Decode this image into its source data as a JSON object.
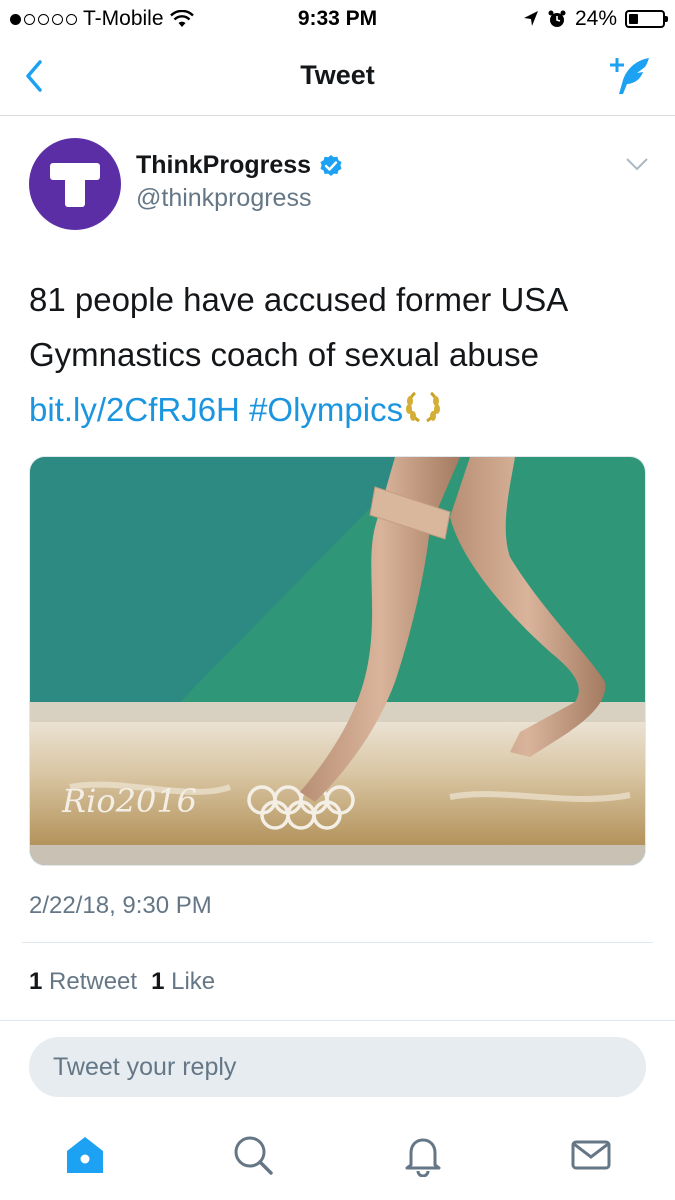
{
  "status_bar": {
    "carrier": "T-Mobile",
    "time": "9:33 PM",
    "battery": "24%",
    "battery_level": 0.24
  },
  "nav": {
    "title": "Tweet",
    "back_icon": "chevron-left-icon",
    "compose_icon": "compose-tweet-icon"
  },
  "tweet": {
    "display_name": "ThinkProgress",
    "handle": "@thinkprogress",
    "verified": true,
    "text_line1": "81 people have accused former USA",
    "text_line2": "Gymnastics coach of sexual abuse",
    "link": "bit.ly/2CfRJ6H",
    "hashtag": "#Olympics",
    "timestamp": "2/22/18, 9:30 PM",
    "media_watermark": "Rio2016"
  },
  "stats": {
    "retweets_count": "1",
    "retweets_label": "Retweet",
    "likes_count": "1",
    "likes_label": "Like"
  },
  "reply": {
    "placeholder": "Tweet your reply"
  },
  "tab_bar": [
    "home-icon",
    "search-icon",
    "notifications-icon",
    "messages-icon"
  ],
  "colors": {
    "accent": "#1da1f2",
    "link": "#1b95e0",
    "avatar_bg": "#5b2ea6",
    "secondary_text": "#657786"
  }
}
